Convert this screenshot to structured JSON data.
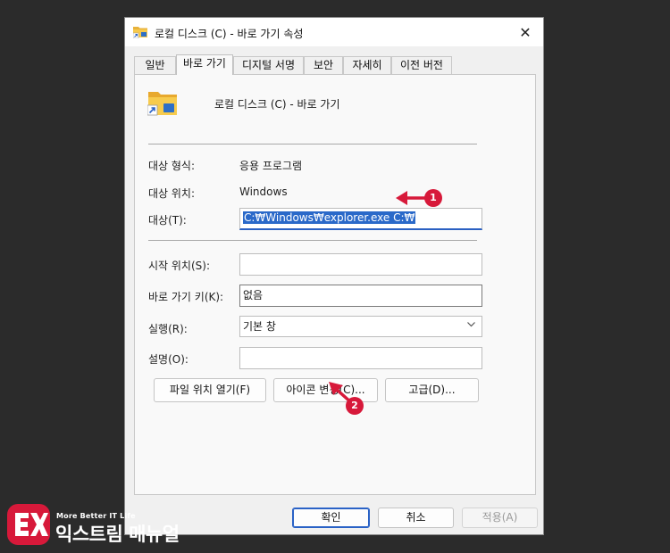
{
  "window": {
    "title": "로컬 디스크 (C) - 바로 가기 속성",
    "close_glyph": "✕"
  },
  "tabs": [
    {
      "label": "일반",
      "active": false
    },
    {
      "label": "바로 가기",
      "active": true
    },
    {
      "label": "디지털 서명",
      "active": false
    },
    {
      "label": "보안",
      "active": false
    },
    {
      "label": "자세히",
      "active": false
    },
    {
      "label": "이전 버전",
      "active": false
    }
  ],
  "shortcut": {
    "name": "로컬 디스크 (C) - 바로 가기",
    "target_type_label": "대상 형식:",
    "target_type_value": "응용 프로그램",
    "target_location_label": "대상 위치:",
    "target_location_value": "Windows",
    "target_label": "대상(T):",
    "target_value": "C:₩Windows₩explorer.exe C:₩",
    "start_in_label": "시작 위치(S):",
    "start_in_value": "",
    "shortcut_key_label": "바로 가기 키(K):",
    "shortcut_key_value": "없음",
    "run_label": "실행(R):",
    "run_value": "기본 창",
    "comment_label": "설명(O):",
    "comment_value": ""
  },
  "buttons": {
    "open_location": "파일 위치 열기(F)",
    "change_icon": "아이콘 변경(C)...",
    "advanced": "고급(D)...",
    "ok": "확인",
    "cancel": "취소",
    "apply": "적용(A)"
  },
  "annotations": {
    "badge1": "1",
    "badge2": "2"
  },
  "watermark": {
    "tagline": "More Better IT Life",
    "name": "익스트림 매뉴얼"
  },
  "colors": {
    "accent": "#2a69c9",
    "annotation_red": "#d7193a"
  }
}
